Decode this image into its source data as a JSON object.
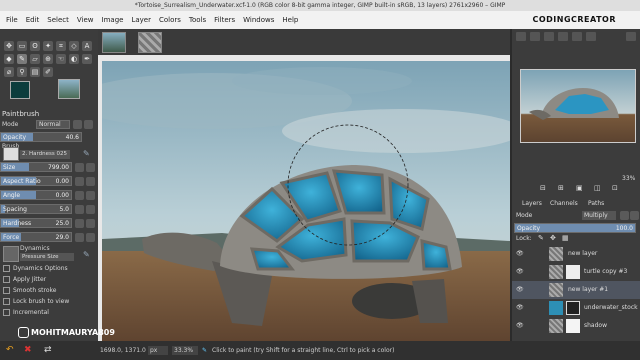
{
  "window": {
    "title": "*Tortoise_Surrealism_Underwater.xcf-1.0 (RGB color 8-bit gamma integer, GIMP built-in sRGB, 13 layers) 2761x2960 – GIMP"
  },
  "menubar": {
    "items": [
      "File",
      "Edit",
      "Select",
      "View",
      "Image",
      "Layer",
      "Colors",
      "Tools",
      "Filters",
      "Windows",
      "Help"
    ]
  },
  "watermarks": {
    "brand": "CODINGCREATOR",
    "handle": "MOHITMAURYA809"
  },
  "tool_options": {
    "title": "Paintbrush",
    "mode_label": "Mode",
    "mode_value": "Normal",
    "opacity_label": "Opacity",
    "opacity_value": "40.6",
    "opacity_fraction": 0.406,
    "brush_label": "Brush",
    "brush_value": "2. Hardness 025",
    "sliders": [
      {
        "label": "Size",
        "value": "799.00",
        "fraction": 0.4
      },
      {
        "label": "Aspect Ratio",
        "value": "0.00",
        "fraction": 0.5
      },
      {
        "label": "Angle",
        "value": "0.00",
        "fraction": 0.5
      },
      {
        "label": "Spacing",
        "value": "5.0",
        "fraction": 0.05
      },
      {
        "label": "Hardness",
        "value": "25.0",
        "fraction": 0.25
      },
      {
        "label": "Force",
        "value": "29.0",
        "fraction": 0.29
      }
    ],
    "dynamics_label": "Dynamics",
    "dynamics_value": "Pressure Size",
    "options": [
      "Dynamics Options",
      "Apply Jitter",
      "Smooth stroke",
      "Lock brush to view",
      "Incremental"
    ]
  },
  "status": {
    "coords": "1698.0, 1371.0",
    "unit": "px",
    "zoom": "33.3%",
    "message": "Click to paint (try Shift for a straight line, Ctrl to pick a color)"
  },
  "navigator": {
    "zoom": "33%"
  },
  "layers_panel": {
    "tabs": [
      "Layers",
      "Channels",
      "Paths"
    ],
    "mode_label": "Mode",
    "mode_value": "Multiply",
    "opacity_label": "Opacity",
    "opacity_value": "100.0",
    "lock_label": "Lock:",
    "layers": [
      {
        "name": "new layer",
        "selected": false
      },
      {
        "name": "turtle copy #3",
        "selected": false
      },
      {
        "name": "new layer #1",
        "selected": true
      },
      {
        "name": "underwater_stock",
        "selected": false
      },
      {
        "name": "shadow",
        "selected": false
      }
    ]
  },
  "colors": {
    "fg": "#0d3d3d",
    "bg": "#ffffff",
    "accent": "#2d8fb5"
  }
}
